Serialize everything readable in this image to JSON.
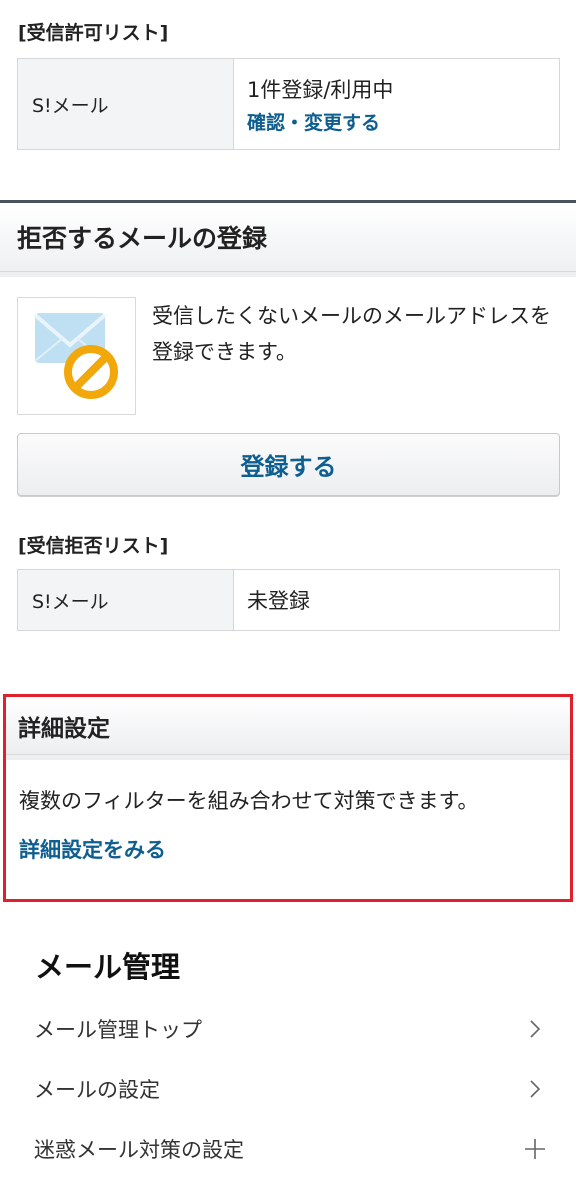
{
  "allow_list": {
    "label": "[受信許可リスト]",
    "row_label": "S!メール",
    "status": "1件登録/利用中",
    "link": "確認・変更する"
  },
  "reject_section": {
    "title": "拒否するメールの登録",
    "description": "受信したくないメールのメールアドレスを登録できます。",
    "icon": "mail-block-icon",
    "button": "登録する"
  },
  "reject_list": {
    "label": "[受信拒否リスト]",
    "row_label": "S!メール",
    "status": "未登録"
  },
  "detail_section": {
    "title": "詳細設定",
    "description": "複数のフィルターを組み合わせて対策できます。",
    "link": "詳細設定をみる",
    "highlight_color": "#e0202a"
  },
  "mail_management": {
    "title": "メール管理",
    "items": [
      {
        "label": "メール管理トップ",
        "icon": "chevron-right-icon"
      },
      {
        "label": "メールの設定",
        "icon": "chevron-right-icon"
      },
      {
        "label": "迷惑メール対策の設定",
        "icon": "plus-icon"
      }
    ]
  },
  "colors": {
    "link": "#0e5e8f",
    "header_border": "#4a5260",
    "table_label_bg": "#f3f4f6"
  }
}
